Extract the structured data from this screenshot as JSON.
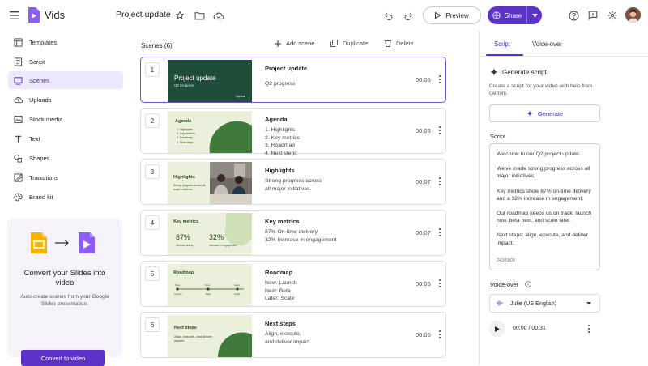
{
  "app": {
    "name": "Vids",
    "doc_title": "Project update",
    "share_label": "Share",
    "preview_label": "Preview"
  },
  "colors": {
    "brand": "#5b34c7",
    "accent": "#7a4cf0",
    "dark_green": "#1f4d3a",
    "light_green": "#eaf0dc"
  },
  "sidebar": {
    "items": [
      {
        "label": "Templates",
        "icon": "templates-icon"
      },
      {
        "label": "Script",
        "icon": "script-icon"
      },
      {
        "label": "Scenes",
        "icon": "scenes-icon"
      },
      {
        "label": "Uploads",
        "icon": "uploads-icon"
      },
      {
        "label": "Stock media",
        "icon": "stock-media-icon"
      },
      {
        "label": "Text",
        "icon": "text-icon"
      },
      {
        "label": "Shapes",
        "icon": "shapes-icon"
      },
      {
        "label": "Transitions",
        "icon": "transitions-icon"
      },
      {
        "label": "Brand kit",
        "icon": "brand-kit-icon"
      }
    ],
    "promo": {
      "title": "Convert your Slides into video",
      "desc": "Auto-create scenes from your Google Slides presentation.",
      "button": "Convert to video"
    }
  },
  "main": {
    "header": "Scenes (6)",
    "actions": {
      "add": "Add scene",
      "duplicate": "Duplicate",
      "delete": "Delete"
    },
    "scenes": [
      {
        "num": "1",
        "title": "Project update",
        "body": [
          "Q2 progress"
        ],
        "time": "00:05",
        "thumb_title": "Project update",
        "thumb_sub": "Q2 progress",
        "thumb_brand": "Cymbal"
      },
      {
        "num": "2",
        "title": "Agenda",
        "body": [
          "1. Highlights",
          "2. Key metrics",
          "3. Roadmap",
          "4. Next steps"
        ],
        "time": "00:06",
        "thumb_title": "Agenda",
        "thumb_items": [
          "1. Highlights",
          "2. Key metrics",
          "3. Roadmap",
          "4. Next steps"
        ]
      },
      {
        "num": "3",
        "title": "Highlights",
        "body": [
          "Strong progress across",
          "all major initiatives."
        ],
        "time": "00:07",
        "thumb_title": "Highlights",
        "thumb_sub": "Strong progress across all major initiatives."
      },
      {
        "num": "4",
        "title": "Key metrics",
        "body": [
          "87% On-time delivery",
          "32% Increase in engagement"
        ],
        "time": "00:07",
        "thumb_title": "Key metrics",
        "thumb_m1": "87%",
        "thumb_m1l": "On-time delivery",
        "thumb_m2": "32%",
        "thumb_m2l": "Increase in engagement"
      },
      {
        "num": "5",
        "title": "Roadmap",
        "body": [
          "Now: Launch",
          "Next: Beta",
          "Later: Scale"
        ],
        "time": "00:06",
        "thumb_title": "Roadmap",
        "thumb_top": [
          "Now",
          "Next",
          "Later"
        ],
        "thumb_bottom": [
          "Launch",
          "Beta",
          "Scale"
        ]
      },
      {
        "num": "6",
        "title": "Next steps",
        "body": [
          "Align, execute,",
          "and deliver impact."
        ],
        "time": "00:05",
        "thumb_title": "Next steps",
        "thumb_sub": "Align, execute, and deliver impact."
      }
    ]
  },
  "right": {
    "tabs": [
      "Script",
      "Voice-over"
    ],
    "generate": {
      "title": "Generate script",
      "desc": "Create a script for your video with help from Gemini.",
      "button": "Generate"
    },
    "script_label": "Script",
    "script_paragraphs": [
      "Welcome to our Q2 project update.",
      "We've made strong progress across all major initiatives.",
      "Key metrics show 87% on-time delivery and a 32% increase in engagement.",
      "Our roadmap keeps us on track: launch now, beta next, and scale later.",
      "Next steps: align, execute, and deliver impact."
    ],
    "char_count": "243/5000",
    "voiceover_label": "Voice-over",
    "voice": "Julie (US English)",
    "player_time": "00:00 / 00:31"
  }
}
